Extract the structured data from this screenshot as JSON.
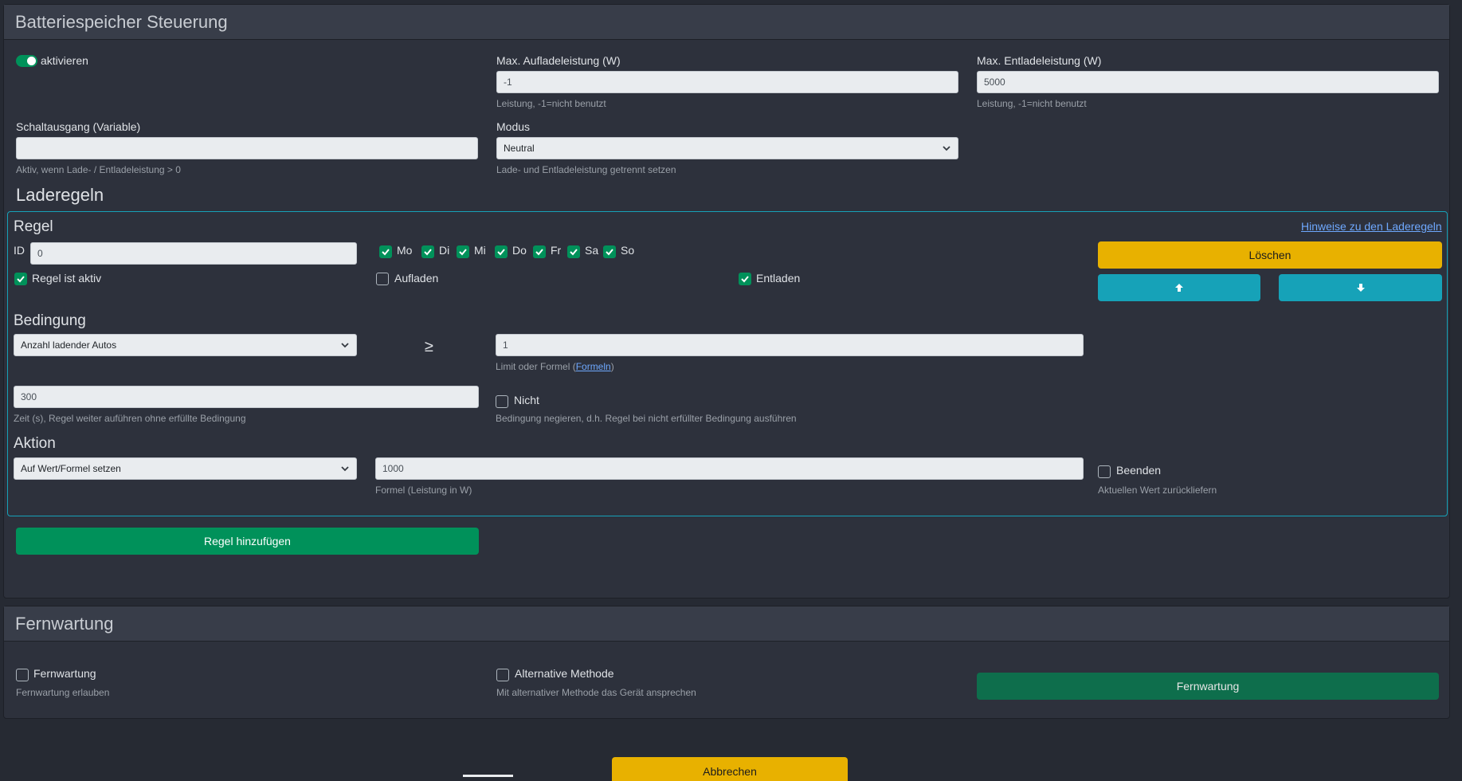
{
  "battery": {
    "title": "Batteriespeicher Steuerung",
    "activate_label": "aktivieren",
    "max_charge": {
      "label": "Max. Aufladeleistung (W)",
      "value": "-1",
      "help": "Leistung, -1=nicht benutzt"
    },
    "max_discharge": {
      "label": "Max. Entladeleistung (W)",
      "value": "5000",
      "help": "Leistung, -1=nicht benutzt"
    },
    "switch_output": {
      "label": "Schaltausgang (Variable)",
      "value": "",
      "help": "Aktiv, wenn Lade- / Entladeleistung > 0"
    },
    "mode": {
      "label": "Modus",
      "value": "Neutral",
      "help": "Lade- und Entladeleistung getrennt setzen"
    },
    "rules_title": "Laderegeln"
  },
  "rule": {
    "title": "Regel",
    "hint_link": "Hinweise zu den Laderegeln",
    "id_label": "ID",
    "id_value": "0",
    "days": [
      "Mo",
      "Di",
      "Mi",
      "Do",
      "Fr",
      "Sa",
      "So"
    ],
    "active_label": "Regel ist aktiv",
    "charge_label": "Aufladen",
    "discharge_label": "Entladen",
    "delete_label": "Löschen",
    "condition": {
      "title": "Bedingung",
      "select_value": "Anzahl ladender Autos",
      "operator": "≥",
      "limit_value": "1",
      "limit_help_prefix": "Limit oder Formel (",
      "limit_help_link": "Formeln",
      "limit_help_suffix": ")",
      "time_value": "300",
      "time_help": "Zeit (s), Regel weiter auführen ohne erfüllte Bedingung",
      "not_label": "Nicht",
      "not_help": "Bedingung negieren, d.h. Regel bei nicht erfüllter Bedingung ausführen"
    },
    "action": {
      "title": "Aktion",
      "select_value": "Auf Wert/Formel setzen",
      "formula_value": "1000",
      "formula_help": "Formel (Leistung in W)",
      "stop_label": "Beenden",
      "stop_help": "Aktuellen Wert zurückliefern"
    }
  },
  "add_rule_label": "Regel hinzufügen",
  "remote": {
    "title": "Fernwartung",
    "checkbox_label": "Fernwartung",
    "checkbox_help": "Fernwartung erlauben",
    "alt_label": "Alternative Methode",
    "alt_help": "Mit alternativer Methode das Gerät ansprechen",
    "button_label": "Fernwartung"
  },
  "cancel_label": "Abbrechen",
  "colors": {
    "green": "#00915a",
    "yellow": "#e8b100",
    "teal": "#16a2b8",
    "dark_green": "#0e6e4c"
  }
}
